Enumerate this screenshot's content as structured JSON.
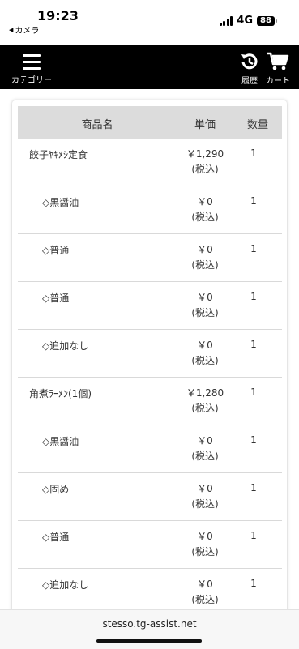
{
  "status_bar": {
    "time": "19:23",
    "back_app": "カメラ",
    "network": "4G",
    "battery": "88"
  },
  "header": {
    "category_label": "カテゴリー",
    "history_label": "履歴",
    "cart_label": "カート",
    "background": "#000000"
  },
  "table": {
    "columns": [
      "商品名",
      "単価",
      "数量"
    ],
    "rows": [
      {
        "name": "餃子ﾔｷﾒｼ定食",
        "price": "￥1,290",
        "tax": "(税込)",
        "qty": "1",
        "sub": false
      },
      {
        "name": "◇黒醤油",
        "price": "￥0",
        "tax": "(税込)",
        "qty": "1",
        "sub": true
      },
      {
        "name": "◇普通",
        "price": "￥0",
        "tax": "(税込)",
        "qty": "1",
        "sub": true
      },
      {
        "name": "◇普通",
        "price": "￥0",
        "tax": "(税込)",
        "qty": "1",
        "sub": true
      },
      {
        "name": "◇追加なし",
        "price": "￥0",
        "tax": "(税込)",
        "qty": "1",
        "sub": true
      },
      {
        "name": "角煮ﾗｰﾒﾝ(1個)",
        "price": "￥1,280",
        "tax": "(税込)",
        "qty": "1",
        "sub": false
      },
      {
        "name": "◇黒醤油",
        "price": "￥0",
        "tax": "(税込)",
        "qty": "1",
        "sub": true
      },
      {
        "name": "◇固め",
        "price": "￥0",
        "tax": "(税込)",
        "qty": "1",
        "sub": true
      },
      {
        "name": "◇普通",
        "price": "￥0",
        "tax": "(税込)",
        "qty": "1",
        "sub": true
      },
      {
        "name": "◇追加なし",
        "price": "￥0",
        "tax": "(税込)",
        "qty": "1",
        "sub": true
      }
    ]
  },
  "browser": {
    "url": "stesso.tg-assist.net"
  }
}
